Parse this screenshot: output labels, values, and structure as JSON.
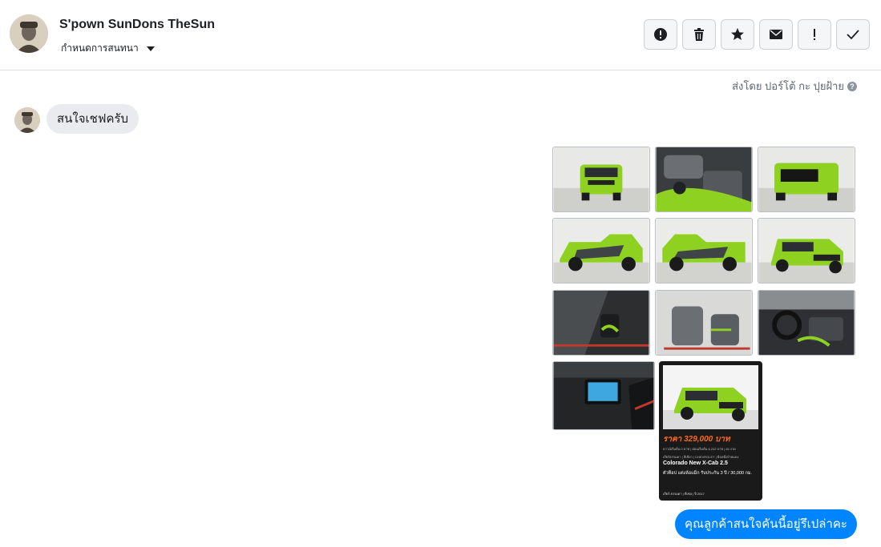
{
  "header": {
    "user_name": "S'pown SunDons TheSun",
    "conversation_menu_label": "กำหนดการสนทนา",
    "actions": [
      "alert-icon",
      "trash-icon",
      "star-icon",
      "envelope-icon",
      "exclamation-icon",
      "check-icon"
    ]
  },
  "sent_by": "ส่งโดย ปอร์โต้ กะ ปุยฝ้าย",
  "messages": {
    "incoming_text": "สนใจเชฟครับ",
    "outgoing_text": "คุณลูกค้าสนใจคันนี้อยู่รึเปล่าคะ"
  },
  "promo": {
    "price": "ราคา 329,000 บาท",
    "line1": "ดาวน์เริ่มต้น 0 บาท | ผ่อนเริ่มต้น 6,242 บาท | 84 งวด",
    "line2": "เกียร์ธรรมดา | สีเขียว | CHEVROLET | มือหนึ่งป้ายแดง",
    "model": "Colorado New X-Cab 2.5",
    "features": "ตัวท็อป แต่งล้อแม็ก รับประกัน 3 ปี / 30,000 กม.",
    "footer": "เกียร์ ธรรมดา | ดีเซล | ปี 2017"
  },
  "colors": {
    "accent_blue": "#0084ff",
    "truck_green": "#8ed121",
    "price_orange": "#ff6a13"
  }
}
